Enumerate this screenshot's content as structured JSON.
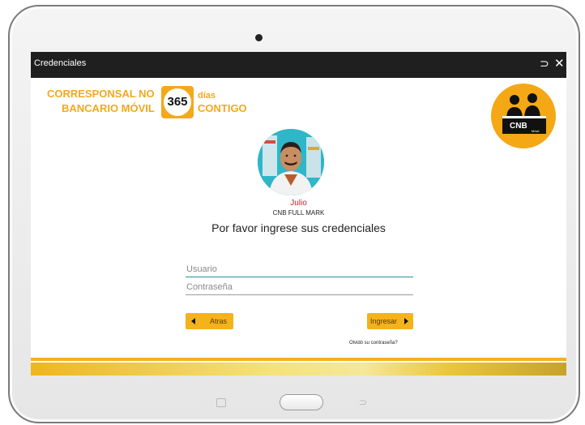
{
  "window": {
    "title": "Credenciales",
    "back_icon": "⊃",
    "close_icon": "✕"
  },
  "brand": {
    "line1": "CORRESPONSAL NO",
    "line2": "BANCARIO MÓVIL",
    "badge": "365",
    "dias": "días",
    "contigo": "CONTIGO",
    "color": "#f4a81c"
  },
  "cnb_logo": {
    "text": "CNB",
    "subtext": "Móvil",
    "color": "#f5a815"
  },
  "user": {
    "name": "Julio",
    "org": "CNB FULL MARK"
  },
  "prompt": "Por favor ingrese sus credenciales",
  "form": {
    "usuario_placeholder": "Usuario",
    "password_placeholder": "Contraseña"
  },
  "buttons": {
    "back_label": "Atras",
    "login_label": "Ingresar"
  },
  "forgot_label": "Olvidó su contraseña?",
  "device_nav": {
    "recents": "recents",
    "home": "home",
    "back": "⊃"
  }
}
